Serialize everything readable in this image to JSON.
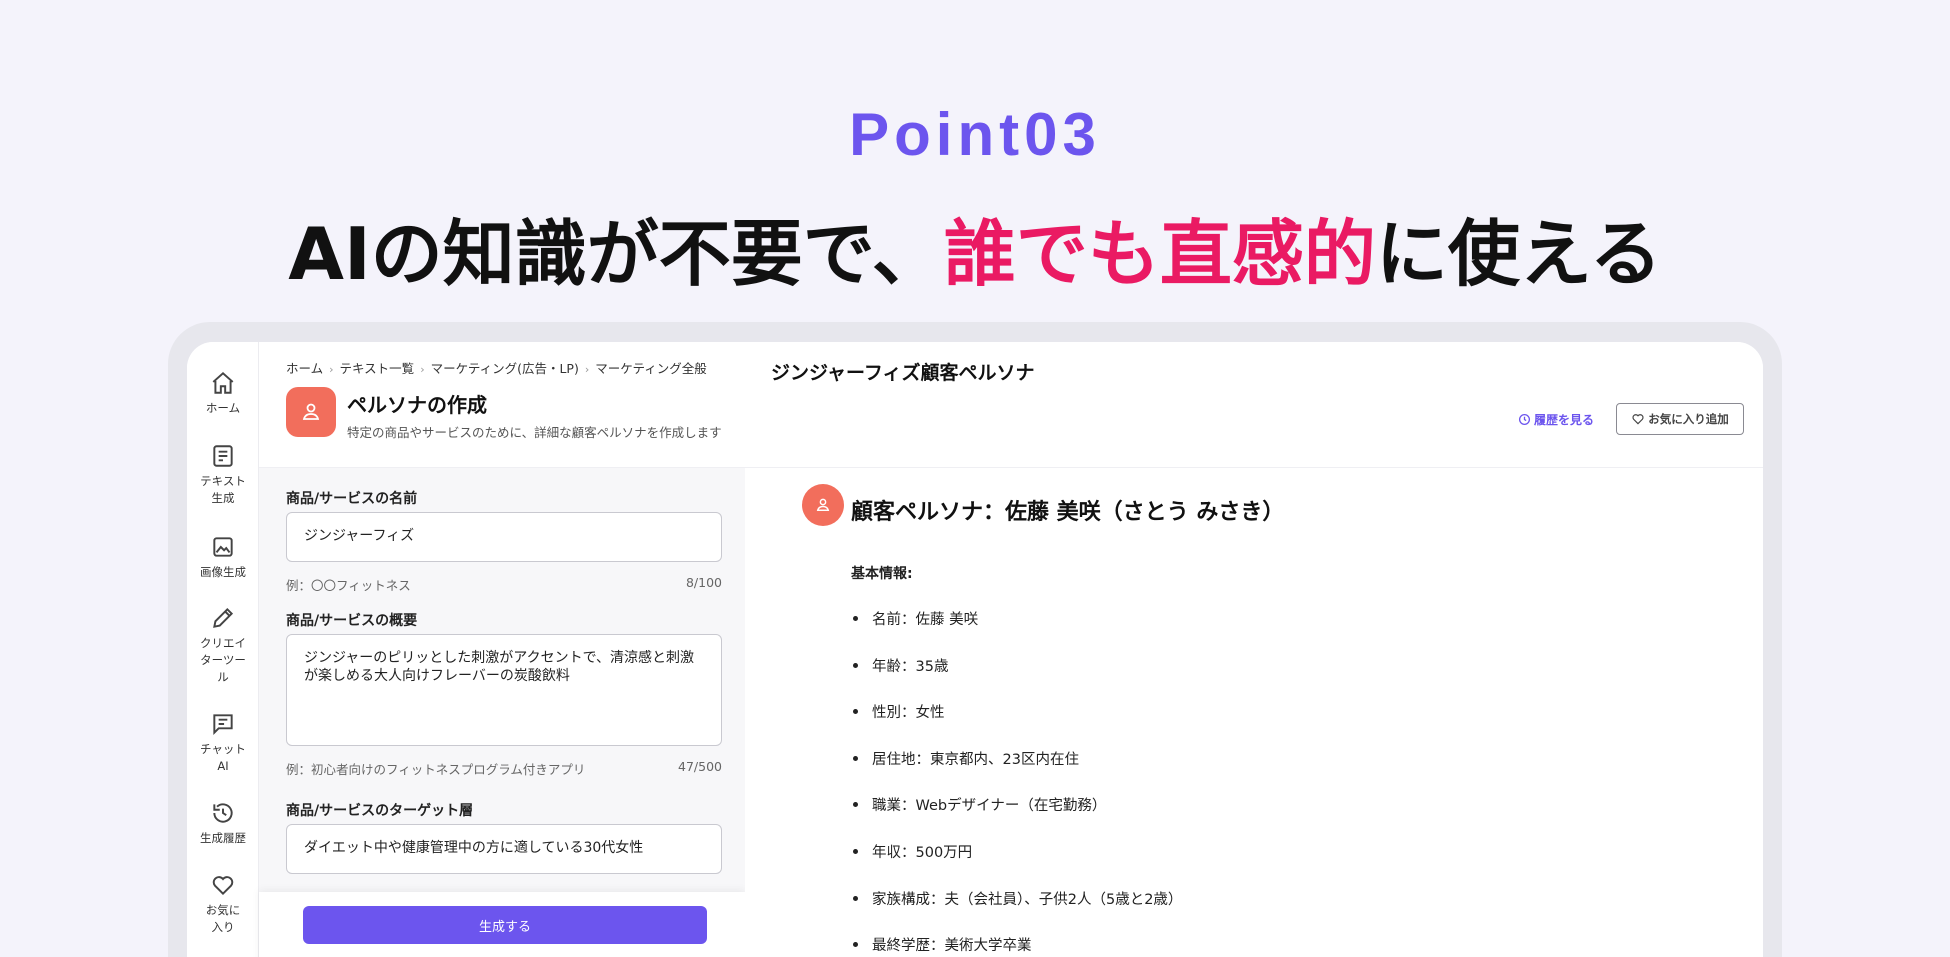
{
  "hero": {
    "point": "Point03",
    "title_before": "AIの知識が不要で、",
    "title_highlight": "誰でも直感的",
    "title_after": "に使える",
    "accent": "#6c55ee",
    "highlight_color": "#ea1a63"
  },
  "sidebar": {
    "items": [
      {
        "label": "ホーム",
        "icon": "home-icon"
      },
      {
        "label": "テキスト生成",
        "icon": "text-doc-icon"
      },
      {
        "label": "画像生成",
        "icon": "image-icon"
      },
      {
        "label": "クリエイターツール",
        "icon": "pencil-icon"
      },
      {
        "label": "チャットAI",
        "icon": "chat-icon"
      },
      {
        "label": "生成履歴",
        "icon": "history-icon"
      },
      {
        "label": "お気に入り",
        "icon": "heart-icon"
      }
    ]
  },
  "form": {
    "breadcrumb": [
      "ホーム",
      "テキスト一覧",
      "マーケティング(広告・LP)",
      "マーケティング全般"
    ],
    "title": "ペルソナの作成",
    "subtitle": "特定の商品やサービスのために、詳細な顧客ペルソナを作成します",
    "fields": [
      {
        "label": "商品/サービスの名前",
        "value": "ジンジャーフィズ",
        "hint": "例：〇〇フィットネス",
        "count": "8/100"
      },
      {
        "label": "商品/サービスの概要",
        "value": "ジンジャーのピリッとした刺激がアクセントで、清涼感と刺激が楽しめる大人向けフレーバーの炭酸飲料",
        "hint": "例：初心者向けのフィットネスプログラム付きアプリ",
        "count": "47/500"
      },
      {
        "label": "商品/サービスのターゲット層",
        "value": "ダイエット中や健康管理中の方に適している30代女性",
        "hint": "",
        "count": ""
      }
    ],
    "generate_label": "生成する"
  },
  "result": {
    "title": "ジンジャーフィズ顧客ペルソナ",
    "history_label": "履歴を見る",
    "favorite_label": "お気に入り追加",
    "persona_heading": "顧客ペルソナ：佐藤 美咲（さとう みさき）",
    "basic_info_label": "基本情報:",
    "items": [
      "名前：佐藤 美咲",
      "年齢：35歳",
      "性別：女性",
      "居住地：東京都内、23区内在住",
      "職業：Webデザイナー（在宅勤務）",
      "年収：500万円",
      "家族構成：夫（会社員）、子供2人（5歳と2歳）",
      "最終学歴：美術大学卒業"
    ]
  }
}
